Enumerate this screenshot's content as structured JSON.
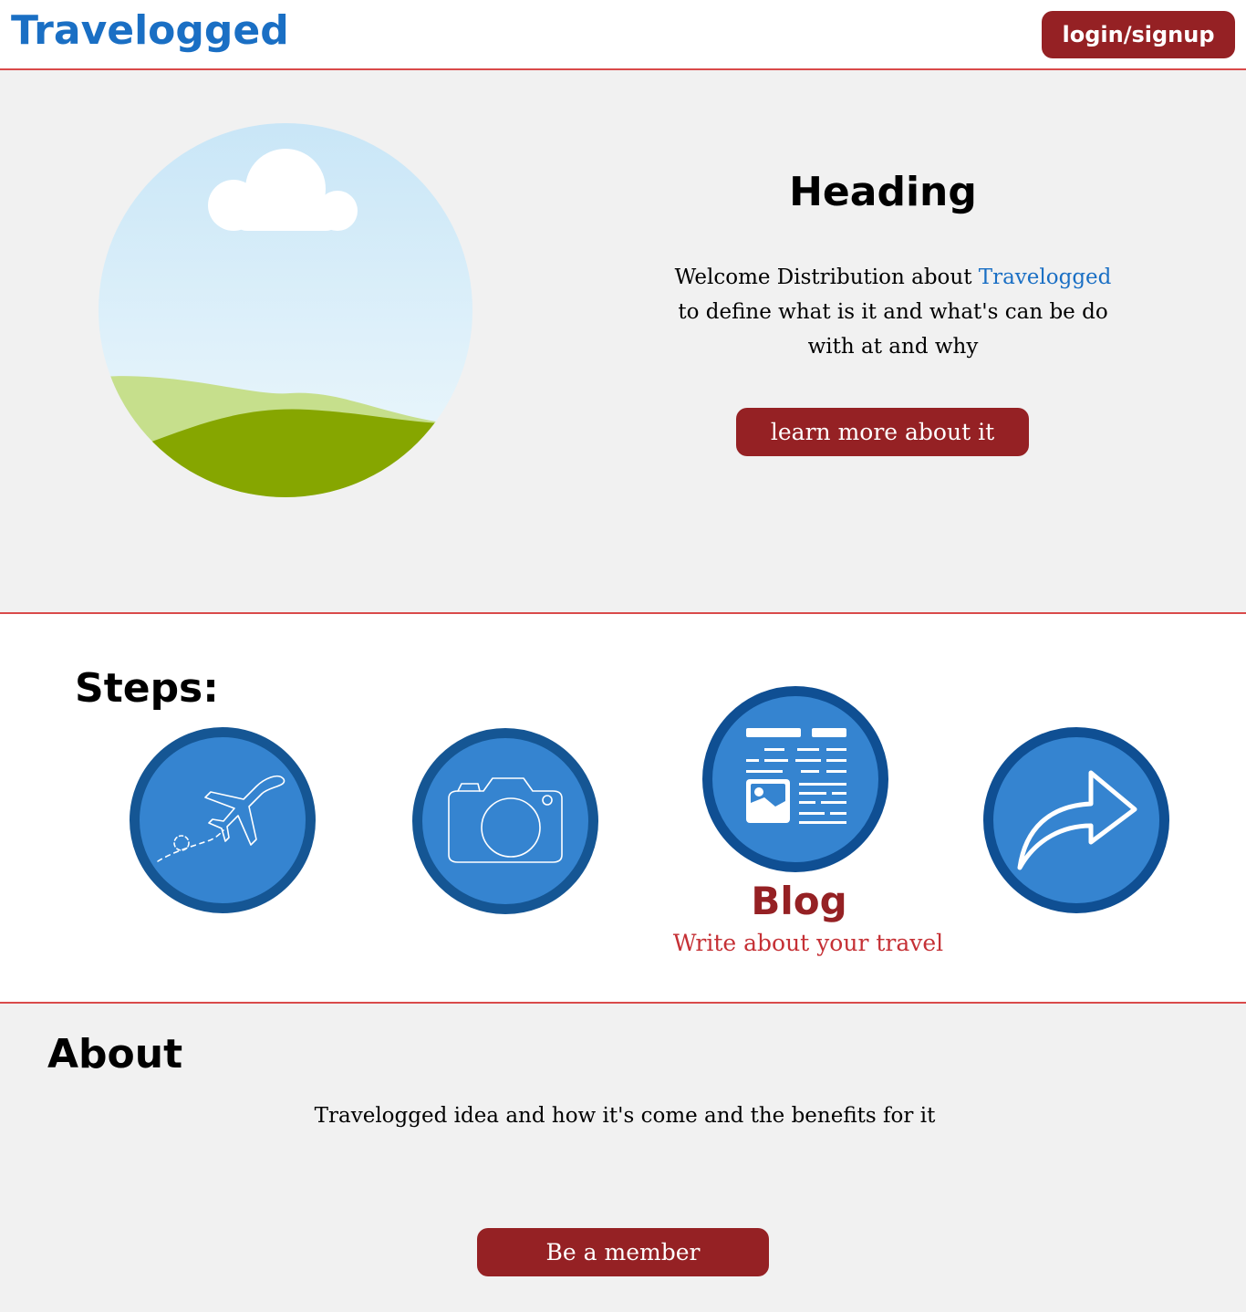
{
  "header": {
    "logo": "Travelogged",
    "login_label": "login/signup"
  },
  "hero": {
    "heading": "Heading",
    "text_before": "Welcome Distribution  about ",
    "text_brand": "Travelogged",
    "text_after": " to define what is it and what's can be do with at and why",
    "button_label": "learn more about it",
    "image_icon": "landscape-icon"
  },
  "steps": {
    "title": "Steps:",
    "items": [
      {
        "icon": "airplane-icon"
      },
      {
        "icon": "camera-icon"
      },
      {
        "icon": "blog-article-icon",
        "label": "Blog",
        "sublabel": "Write about your travel"
      },
      {
        "icon": "share-arrow-icon"
      }
    ]
  },
  "about": {
    "title": "About",
    "text": "Travelogged idea and how it's come and the benefits for it",
    "button_label": "Be a member"
  },
  "colors": {
    "brand_blue": "#1a6fc4",
    "button_red": "#952124",
    "divider_red": "#d94a4a",
    "step_blue": "#3584d0",
    "step_border": "#155694"
  }
}
